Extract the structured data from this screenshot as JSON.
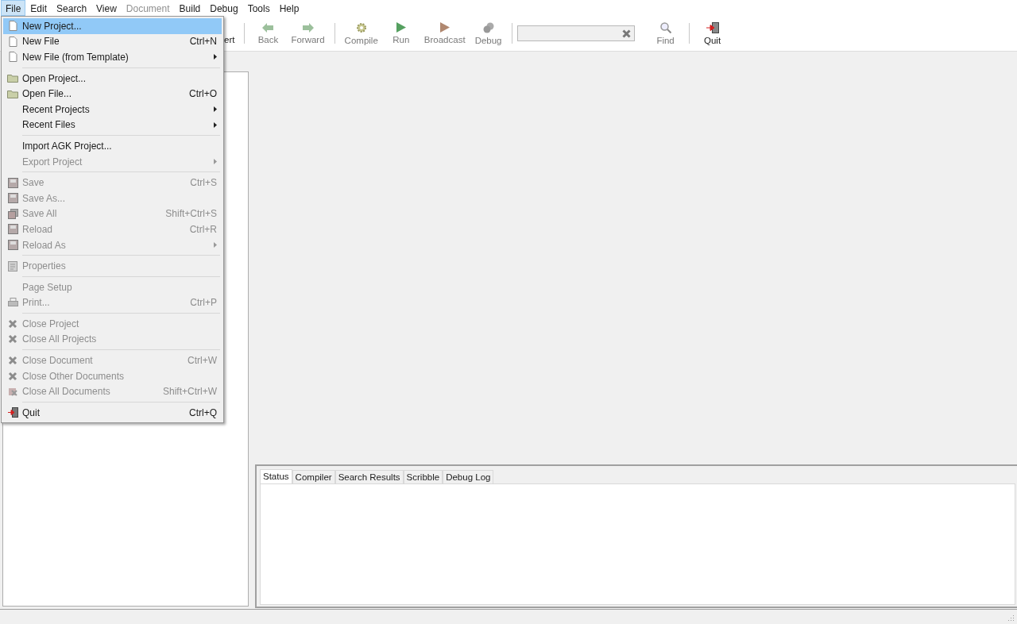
{
  "menubar": [
    {
      "label": "File",
      "selected": true,
      "disabled": false
    },
    {
      "label": "Edit",
      "selected": false,
      "disabled": false
    },
    {
      "label": "Search",
      "selected": false,
      "disabled": false
    },
    {
      "label": "View",
      "selected": false,
      "disabled": false
    },
    {
      "label": "Document",
      "selected": false,
      "disabled": true
    },
    {
      "label": "Build",
      "selected": false,
      "disabled": false
    },
    {
      "label": "Debug",
      "selected": false,
      "disabled": false
    },
    {
      "label": "Tools",
      "selected": false,
      "disabled": false
    },
    {
      "label": "Help",
      "selected": false,
      "disabled": false
    }
  ],
  "file_menu": [
    [
      {
        "label": "New Project...",
        "kind": "page",
        "selected": true,
        "disabled": false,
        "submenu": false
      },
      {
        "label": "New File",
        "shortcut": "Ctrl+N",
        "kind": "page",
        "selected": false,
        "disabled": false,
        "submenu": false
      },
      {
        "label": "New File (from Template)",
        "kind": "page",
        "selected": false,
        "disabled": false,
        "submenu": true
      }
    ],
    [
      {
        "label": "Open Project...",
        "kind": "folder",
        "selected": false,
        "disabled": false,
        "submenu": false
      },
      {
        "label": "Open File...",
        "shortcut": "Ctrl+O",
        "kind": "folder",
        "selected": false,
        "disabled": false,
        "submenu": false
      },
      {
        "label": "Recent Projects",
        "kind": "none",
        "selected": false,
        "disabled": false,
        "submenu": true
      },
      {
        "label": "Recent Files",
        "kind": "none",
        "selected": false,
        "disabled": false,
        "submenu": true
      }
    ],
    [
      {
        "label": "Import AGK Project...",
        "kind": "none",
        "selected": false,
        "disabled": false,
        "submenu": false
      },
      {
        "label": "Export Project",
        "kind": "none",
        "selected": false,
        "disabled": true,
        "submenu": true
      }
    ],
    [
      {
        "label": "Save",
        "shortcut": "Ctrl+S",
        "kind": "disk",
        "selected": false,
        "disabled": true,
        "submenu": false
      },
      {
        "label": "Save As...",
        "kind": "disk",
        "selected": false,
        "disabled": true,
        "submenu": false
      },
      {
        "label": "Save All",
        "shortcut": "Shift+Ctrl+S",
        "kind": "disks",
        "selected": false,
        "disabled": true,
        "submenu": false
      },
      {
        "label": "Reload",
        "shortcut": "Ctrl+R",
        "kind": "disk",
        "selected": false,
        "disabled": true,
        "submenu": false
      },
      {
        "label": "Reload As",
        "kind": "disk",
        "selected": false,
        "disabled": true,
        "submenu": true
      }
    ],
    [
      {
        "label": "Properties",
        "kind": "props",
        "selected": false,
        "disabled": true,
        "submenu": false
      }
    ],
    [
      {
        "label": "Page Setup",
        "kind": "none",
        "selected": false,
        "disabled": true,
        "submenu": false
      },
      {
        "label": "Print...",
        "shortcut": "Ctrl+P",
        "kind": "printer",
        "selected": false,
        "disabled": true,
        "submenu": false
      }
    ],
    [
      {
        "label": "Close Project",
        "kind": "close",
        "selected": false,
        "disabled": true,
        "submenu": false
      },
      {
        "label": "Close All Projects",
        "kind": "close",
        "selected": false,
        "disabled": true,
        "submenu": false
      }
    ],
    [
      {
        "label": "Close Document",
        "shortcut": "Ctrl+W",
        "kind": "close",
        "selected": false,
        "disabled": true,
        "submenu": false
      },
      {
        "label": "Close Other Documents",
        "kind": "close",
        "selected": false,
        "disabled": true,
        "submenu": false
      },
      {
        "label": "Close All Documents",
        "shortcut": "Shift+Ctrl+W",
        "kind": "closeall",
        "selected": false,
        "disabled": true,
        "submenu": false
      }
    ],
    [
      {
        "label": "Quit",
        "shortcut": "Ctrl+Q",
        "kind": "quit",
        "selected": false,
        "disabled": false,
        "submenu": false
      }
    ]
  ],
  "toolbar": [
    {
      "kind": "partial",
      "label": "ert",
      "disabled": false
    },
    {
      "kind": "separator"
    },
    {
      "kind": "back",
      "label": "Back",
      "disabled": true
    },
    {
      "kind": "forward",
      "label": "Forward",
      "disabled": true
    },
    {
      "kind": "separator"
    },
    {
      "kind": "compile",
      "label": "Compile",
      "disabled": true
    },
    {
      "kind": "run",
      "label": "Run",
      "disabled": true
    },
    {
      "kind": "broadcast",
      "label": "Broadcast",
      "disabled": true
    },
    {
      "kind": "debug",
      "label": "Debug",
      "disabled": true
    },
    {
      "kind": "separator"
    },
    {
      "kind": "search"
    },
    {
      "kind": "find",
      "label": "Find",
      "disabled": true
    },
    {
      "kind": "separator"
    },
    {
      "kind": "quit",
      "label": "Quit",
      "disabled": false
    }
  ],
  "message_tabs": [
    {
      "label": "Status",
      "selected": true
    },
    {
      "label": "Compiler",
      "selected": false
    },
    {
      "label": "Search Results",
      "selected": false
    },
    {
      "label": "Scribble",
      "selected": false
    },
    {
      "label": "Debug Log",
      "selected": false
    }
  ]
}
